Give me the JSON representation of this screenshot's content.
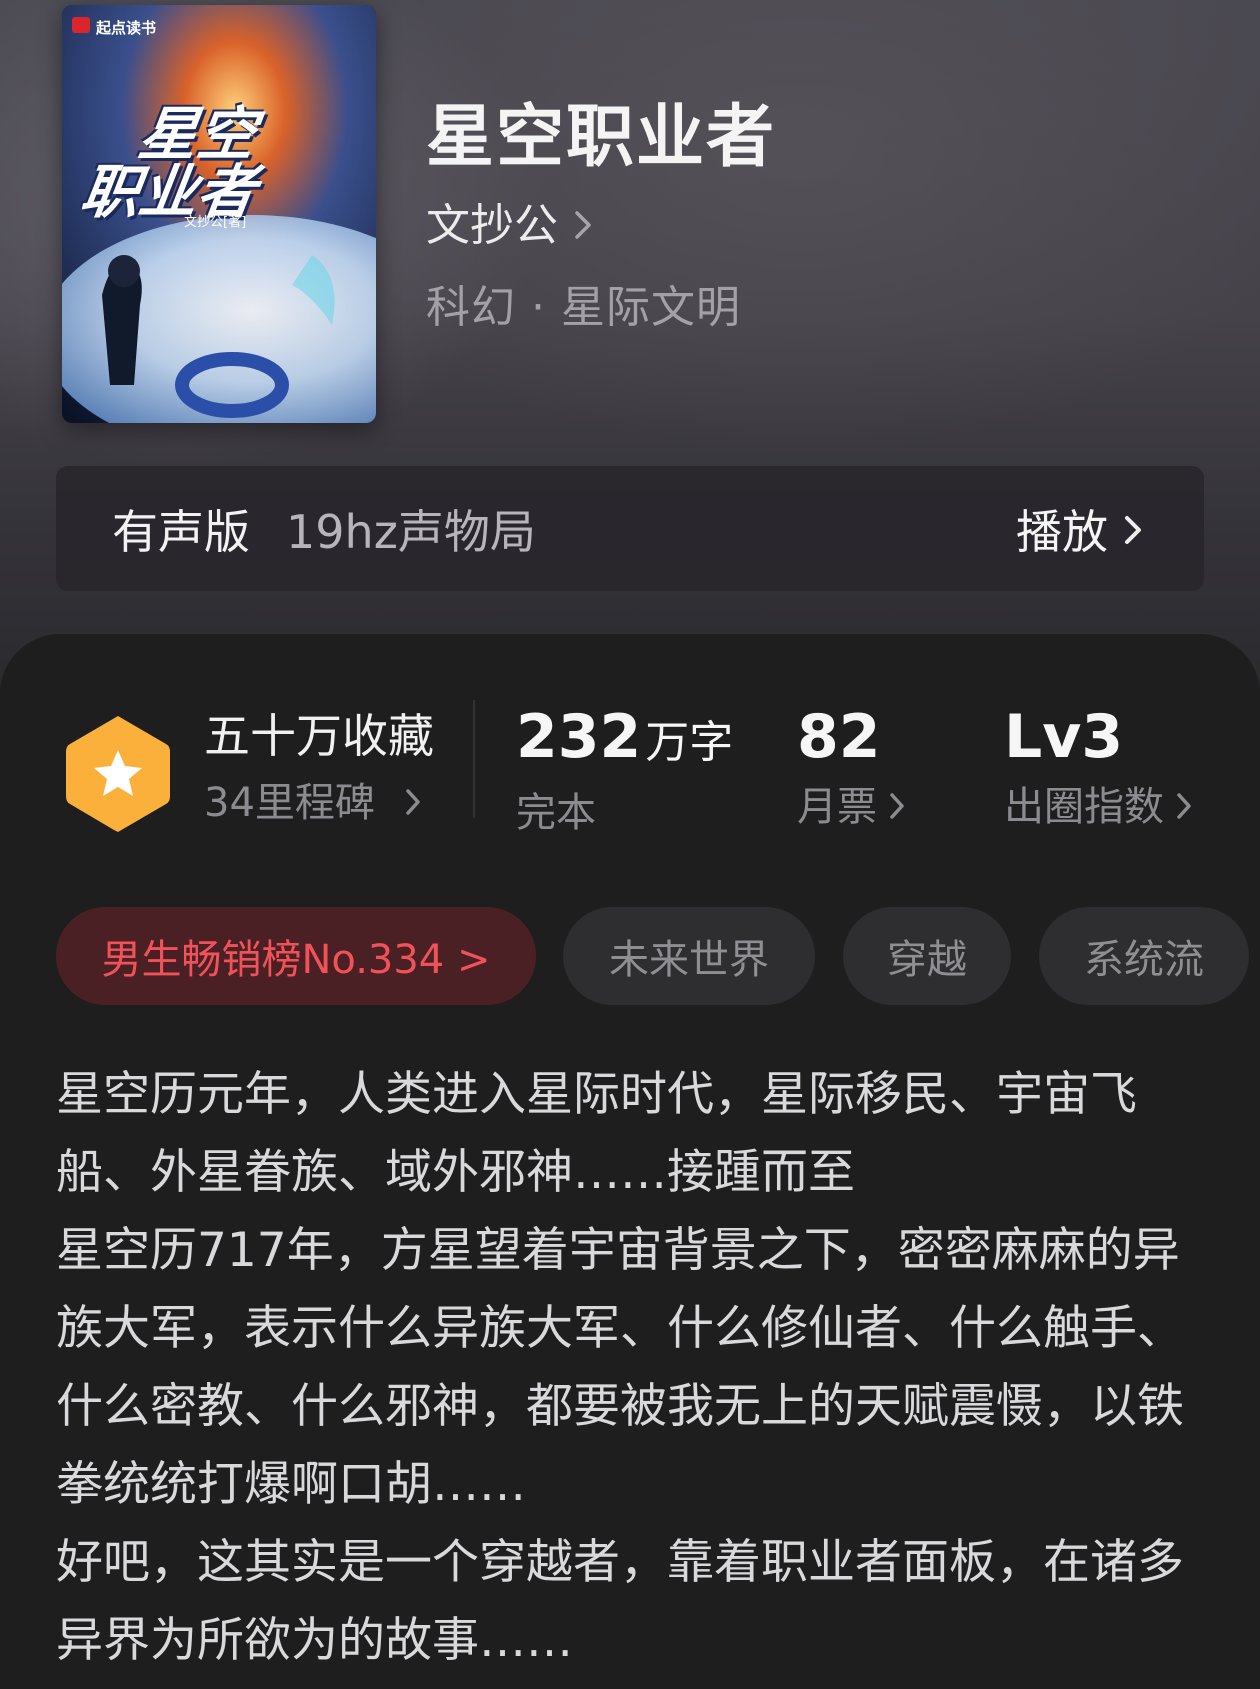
{
  "book": {
    "title": "星空职业者",
    "author": "文抄公",
    "genre": "科幻 · 星际文明",
    "cover": {
      "publisher_label": "起点读书",
      "cover_title_line1": "星空",
      "cover_title_line2": "职业者",
      "cover_author": "文抄公[著]"
    }
  },
  "audio": {
    "label": "有声版",
    "provider": "19hz声物局",
    "play_label": "播放"
  },
  "stats": {
    "collection_title": "五十万收藏",
    "milestones": "34里程碑",
    "word_count_number": "232",
    "word_count_unit": "万字",
    "status": "完本",
    "monthly_votes": "82",
    "monthly_votes_label": "月票",
    "level": "Lv3",
    "level_label": "出圈指数"
  },
  "tags": {
    "rank": "男生畅销榜No.334 >",
    "items": [
      "未来世界",
      "穿越",
      "系统流"
    ]
  },
  "synopsis": [
    "星空历元年，人类进入星际时代，星际移民、宇宙飞船、外星眷族、域外邪神……接踵而至",
    "星空历717年，方星望着宇宙背景之下，密密麻麻的异族大军，表示什么异族大军、什么修仙者、什么触手、什么密教、什么邪神，都要被我无上的天赋震慑，以铁拳统统打爆啊口胡……",
    "好吧，这其实是一个穿越者，靠着职业者面板，在诸多异界为所欲为的故事……"
  ],
  "colors": {
    "accent_red": "#f1525a",
    "badge_orange": "#fbb03b",
    "panel_bg": "#1e1e1f"
  },
  "icons": {
    "badge": "star-hexagon-icon",
    "chevron": "chevron-right-icon"
  }
}
